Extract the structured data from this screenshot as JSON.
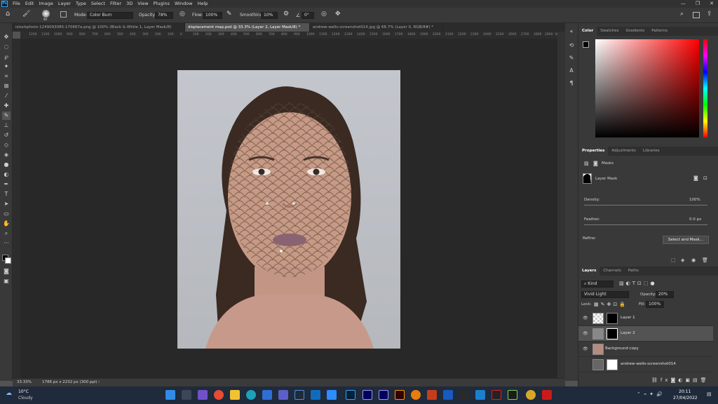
{
  "app_logo": "Ps",
  "menu": [
    "File",
    "Edit",
    "Image",
    "Layer",
    "Type",
    "Select",
    "Filter",
    "3D",
    "View",
    "Plugins",
    "Window",
    "Help"
  ],
  "options": {
    "brush_size": "80",
    "mode_label": "Mode:",
    "mode_value": "Color Burn",
    "opacity_label": "Opacity:",
    "opacity_value": "78%",
    "flow_label": "Flow:",
    "flow_value": "100%",
    "smoothing_label": "Smoothing:",
    "smoothing_value": "10%",
    "angle_value": "0°"
  },
  "tabs": [
    "istockphoto-1249093085-170667a.png @ 100% (Black & White 1, Layer Mask/8)",
    "displacement map.psd @ 33.3% (Layer 2, Layer Mask/8) *",
    "andrew-wells-screenshot014.jpg @ 66.7% (Layer 0, RGB/8#) *"
  ],
  "ruler_labels": [
    "1200",
    "1100",
    "1000",
    "900",
    "800",
    "700",
    "600",
    "500",
    "400",
    "300",
    "200",
    "100",
    "0",
    "100",
    "200",
    "300",
    "400",
    "500",
    "600",
    "700",
    "800",
    "900",
    "1000",
    "1100",
    "1200",
    "1300",
    "1400",
    "1500",
    "1600",
    "1700",
    "1800",
    "1900",
    "2000",
    "2100",
    "2200",
    "2300",
    "2400",
    "2500",
    "2600",
    "2700",
    "2800",
    "2900",
    "3000"
  ],
  "status": {
    "zoom": "33.33%",
    "doc": "1786 px x 2232 px (300 ppi)"
  },
  "color_panel": {
    "tabs": [
      "Color",
      "Swatches",
      "Gradients",
      "Patterns"
    ],
    "hue": "#ff0000"
  },
  "properties": {
    "tabs": [
      "Properties",
      "Adjustments",
      "Libraries"
    ],
    "masks_label": "Masks",
    "layer_mask_label": "Layer Mask",
    "density_label": "Density:",
    "density_value": "100%",
    "feather_label": "Feather:",
    "feather_value": "0.0 px",
    "refine_label": "Refine:",
    "select_mask_button": "Select and Mask..."
  },
  "layers_panel": {
    "tabs": [
      "Layers",
      "Channels",
      "Paths"
    ],
    "kind_label": "Kind",
    "blend_mode": "Vivid Light",
    "opacity_label": "Opacity:",
    "opacity_value": "20%",
    "lock_label": "Lock:",
    "fill_label": "Fill:",
    "fill_value": "100%",
    "layers": [
      "Layer 1",
      "Layer 2",
      "Background copy",
      "andrew-wells-screenshot014"
    ]
  },
  "taskbar": {
    "temp": "10°C",
    "weather": "Cloudy",
    "time": "20:11",
    "date": "27/04/2022"
  }
}
